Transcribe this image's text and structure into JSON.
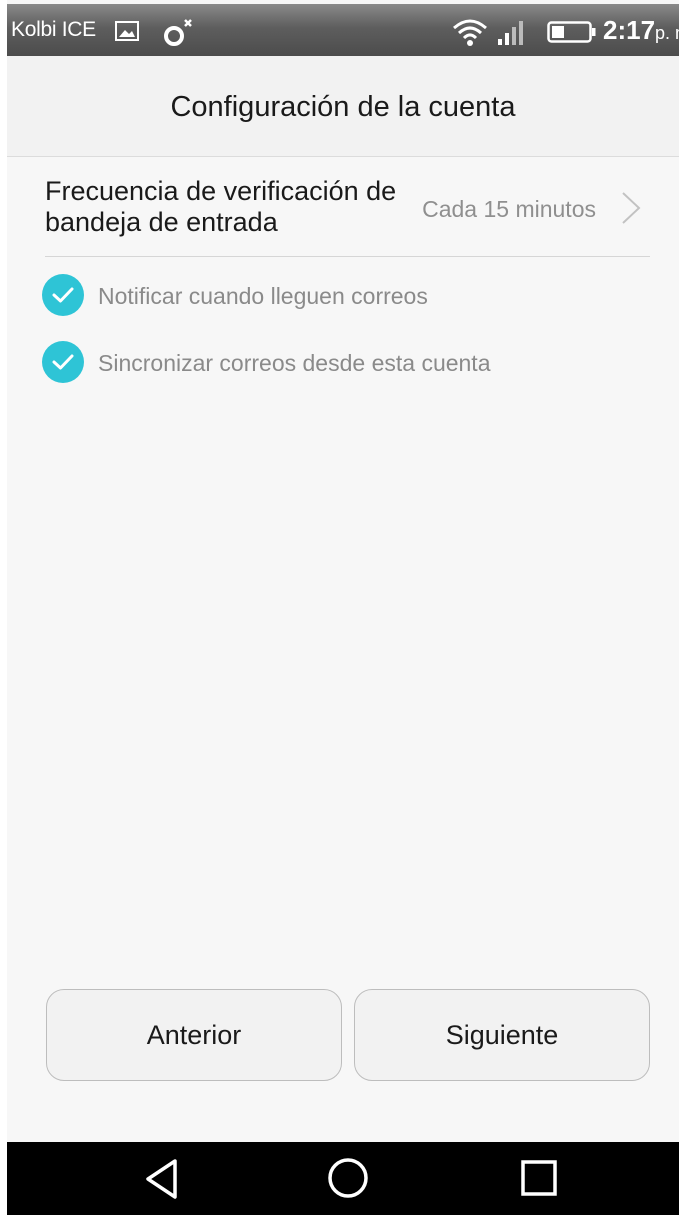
{
  "status_bar": {
    "carrier": "Kolbi ICE",
    "time": "2:17",
    "ampm": "p. m",
    "icons": [
      "gallery-icon",
      "vpn-icon",
      "wifi-icon",
      "signal-icon",
      "battery-icon"
    ]
  },
  "header": {
    "title": "Configuración de la cuenta"
  },
  "settings": {
    "check_frequency": {
      "label": "Frecuencia de verificación de bandeja de entrada",
      "value": "Cada 15 minutos"
    },
    "checkboxes": [
      {
        "label": "Notificar cuando lleguen correos",
        "checked": true
      },
      {
        "label": "Sincronizar correos desde esta cuenta",
        "checked": true
      }
    ]
  },
  "buttons": {
    "previous": "Anterior",
    "next": "Siguiente"
  },
  "nav_bar": {
    "icons": [
      "back-icon",
      "home-icon",
      "recent-apps-icon"
    ]
  },
  "colors": {
    "accent": "#2ec4d6",
    "background": "#f7f7f7",
    "secondary_text": "#8f8f8f"
  }
}
